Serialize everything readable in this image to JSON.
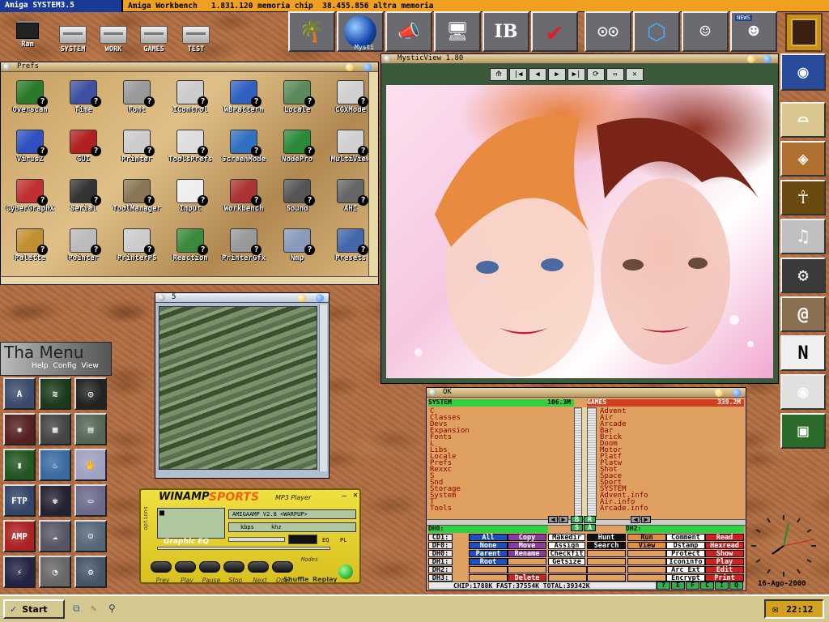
{
  "topbar": {
    "title": "Amiga SYSTEM3.5",
    "info": "Amiga Workbench   1.831.120 memoria chip  38.455.856 altra memoria"
  },
  "desktop_icons": [
    {
      "label": "Ram",
      "icon": "chip-icon"
    },
    {
      "label": "SYSTEM",
      "icon": "disk-icon"
    },
    {
      "label": "WORK",
      "icon": "disk-icon"
    },
    {
      "label": "GAMES",
      "icon": "disk-icon"
    },
    {
      "label": "TEST",
      "icon": "disk-icon"
    }
  ],
  "dock": {
    "sub_label": "Mysti",
    "news_badge": "NEWS"
  },
  "prefs": {
    "title": "Prefs",
    "icons": [
      {
        "label": "Overscan",
        "color": "#2a7a2a"
      },
      {
        "label": "Time",
        "color": "#4050a0"
      },
      {
        "label": "Font",
        "color": "#999999"
      },
      {
        "label": "IControl",
        "color": "#cccccc"
      },
      {
        "label": "WBPattern",
        "color": "#3060c0"
      },
      {
        "label": "Locale",
        "color": "#5a8a5a"
      },
      {
        "label": "CGXMode",
        "color": "#d0d0d0"
      },
      {
        "label": "VirusZ",
        "color": "#3050c0"
      },
      {
        "label": "GUI",
        "color": "#b02020"
      },
      {
        "label": "Printer",
        "color": "#cccccc"
      },
      {
        "label": "ToolsPrefs",
        "color": "#dddddd"
      },
      {
        "label": "ScreenMode",
        "color": "#3070c0"
      },
      {
        "label": "NodePro",
        "color": "#2a8a3a"
      },
      {
        "label": "MultiView",
        "color": "#d0d0d0"
      },
      {
        "label": "CyberGraphX",
        "color": "#c03030"
      },
      {
        "label": "Serial",
        "color": "#333333"
      },
      {
        "label": "ToolManager",
        "color": "#887755"
      },
      {
        "label": "Input",
        "color": "#eeeeee"
      },
      {
        "label": "Workbench",
        "color": "#aa3333"
      },
      {
        "label": "Sound",
        "color": "#555555"
      },
      {
        "label": "AHI",
        "color": "#666666"
      },
      {
        "label": "Palette",
        "color": "#c09030"
      },
      {
        "label": "Pointer",
        "color": "#bbbbbb"
      },
      {
        "label": "PrinterPS",
        "color": "#cccccc"
      },
      {
        "label": "Reaction",
        "color": "#3a8a3a"
      },
      {
        "label": "PrinterGfx",
        "color": "#999999"
      },
      {
        "label": "Nmp",
        "color": "#8899bb"
      },
      {
        "label": "Presets",
        "color": "#4466aa"
      }
    ]
  },
  "mystic": {
    "title": "MysticView 1.80",
    "controls": [
      "⟰",
      "|◀",
      "◀",
      "▶",
      "▶|",
      "⟳",
      "⇔",
      "✕"
    ]
  },
  "win5": {
    "title": "5"
  },
  "thamenu": {
    "title": "Tha Menu",
    "menu": [
      "Help",
      "Config",
      "View"
    ],
    "buttons": [
      {
        "name": "a-button",
        "sym": "A",
        "bg": "#3a4a6a"
      },
      {
        "name": "sound-button",
        "sym": "≋",
        "bg": "#1a3a1a"
      },
      {
        "name": "spiral-button",
        "sym": "◎",
        "bg": "#222222"
      },
      {
        "name": "fire-button",
        "sym": "✺",
        "bg": "#552020"
      },
      {
        "name": "device-button",
        "sym": "▦",
        "bg": "#444444"
      },
      {
        "name": "disk-button",
        "sym": "▤",
        "bg": "#556655"
      },
      {
        "name": "bars-button",
        "sym": "▮",
        "bg": "#225522"
      },
      {
        "name": "cup-button",
        "sym": "♨",
        "bg": "#3a6aa0"
      },
      {
        "name": "hand-button",
        "sym": "✋",
        "bg": "#a0a0c0"
      },
      {
        "name": "ftp-button",
        "sym": "FTP",
        "bg": "#334466"
      },
      {
        "name": "butterfly-button",
        "sym": "✾",
        "bg": "#222233"
      },
      {
        "name": "monitor-button",
        "sym": "▭",
        "bg": "#6a6a8a"
      },
      {
        "name": "amp-button",
        "sym": "AMP",
        "bg": "#aa2222"
      },
      {
        "name": "cloud-button",
        "sym": "☁",
        "bg": "#555566"
      },
      {
        "name": "face-button",
        "sym": "☺",
        "bg": "#556677"
      },
      {
        "name": "lightning-button",
        "sym": "⚡",
        "bg": "#222244"
      },
      {
        "name": "gauge-button",
        "sym": "◔",
        "bg": "#666666"
      },
      {
        "name": "tool-button",
        "sym": "⚙",
        "bg": "#445566"
      }
    ]
  },
  "winamp": {
    "brand": "WINAMP",
    "sports": "SPORTS",
    "sub": "MP3 Player",
    "options": "options",
    "eq": "Graphic EQ",
    "song": "AMIGAAMP V2.8 <WARPUP>",
    "kbps": "kbps",
    "khz": "khz",
    "eq_lbl": "EQ",
    "pl_lbl": "PL",
    "modes": "Modes",
    "shuffle": "Shuffle",
    "replay": "Replay",
    "buttons": [
      "Prev",
      "Play",
      "Pause",
      "Stop",
      "Next",
      "Open"
    ]
  },
  "dopus": {
    "title": "OK",
    "left": {
      "header": "SYSTEM",
      "size": "106.3M",
      "items": [
        "C",
        "Classes",
        "Devs",
        "Expansion",
        "Fonts",
        "L",
        "Libs",
        "Locale",
        "Prefs",
        "Rexxc",
        "S",
        "Snd",
        "Storage",
        "System",
        "T",
        "Tools"
      ]
    },
    "right": {
      "header": "GAMES",
      "size": "339.2M",
      "items": [
        "Advent",
        "Air",
        "Arcade",
        "Bar",
        "Brick",
        "Doom",
        "Motor",
        "Platf",
        "Platw",
        "Shot",
        "Space",
        "Sport",
        "SYSTEM",
        "Advent.info",
        "Air.info",
        "Arcade.info"
      ]
    },
    "mid_buttons": [
      "B",
      "R",
      "S",
      "A"
    ],
    "path_left": "DH0:",
    "path_right": "DH2:",
    "drives": [
      "CD1:",
      "DF0:",
      "DH0:",
      "DH1:",
      "DH2:",
      "DH3:"
    ],
    "col1": [
      {
        "t": "All",
        "c": "#1a50c0"
      },
      {
        "t": "None",
        "c": "#1a50c0"
      },
      {
        "t": "Parent",
        "c": "#1a50c0"
      },
      {
        "t": "Root",
        "c": "#1a50c0"
      }
    ],
    "col2": [
      {
        "t": "Copy",
        "c": "#8a3aa0"
      },
      {
        "t": "Move",
        "c": "#8a3aa0"
      },
      {
        "t": "Rename",
        "c": "#8a3aa0"
      },
      {
        "t": "Delete",
        "c": "#d02020"
      }
    ],
    "col3": [
      {
        "t": "Makedir",
        "c": "#ffffff"
      },
      {
        "t": "Assign",
        "c": "#ffffff"
      },
      {
        "t": "Checkfit",
        "c": "#ffffff"
      },
      {
        "t": "Getsize",
        "c": "#ffffff"
      }
    ],
    "col4": [
      {
        "t": "Hunt",
        "c": "#111111"
      },
      {
        "t": "Search",
        "c": "#111111"
      }
    ],
    "col5": [
      {
        "t": "Run",
        "c": "#e09040"
      },
      {
        "t": "View",
        "c": "#e09040"
      }
    ],
    "col6": [
      {
        "t": "Comment",
        "c": "#ffffff"
      },
      {
        "t": "Dstamp",
        "c": "#ffffff"
      },
      {
        "t": "Protect",
        "c": "#ffffff"
      },
      {
        "t": "Iconinfo",
        "c": "#ffffff"
      },
      {
        "t": "Arc Ext",
        "c": "#ffffff"
      },
      {
        "t": "Encrypt",
        "c": "#ffffff"
      }
    ],
    "col7": [
      {
        "t": "Read",
        "c": "#d02020"
      },
      {
        "t": "Hexread",
        "c": "#d02020"
      },
      {
        "t": "Show",
        "c": "#d02020"
      },
      {
        "t": "Play",
        "c": "#d02020"
      },
      {
        "t": "Edit",
        "c": "#d02020"
      },
      {
        "t": "Print",
        "c": "#d02020"
      }
    ],
    "status": "CHIP:1788K  FAST:37554K  TOTAL:39342K",
    "status_btns": [
      "?",
      "E",
      "F",
      "C",
      "I",
      "Q"
    ]
  },
  "clock": {
    "date": "16-Ago-2000"
  },
  "taskbar": {
    "start": "Start",
    "time": "22:12"
  },
  "right_dock": [
    {
      "name": "eye-globe-button",
      "bg": "#2a4a9a",
      "sym": "◉"
    },
    {
      "name": "mouse-button",
      "bg": "#d8c890",
      "sym": "⌓"
    },
    {
      "name": "picture-eye-button",
      "bg": "#b07030",
      "sym": "◈"
    },
    {
      "name": "pharaoh-button",
      "bg": "#6a4a10",
      "sym": "☥"
    },
    {
      "name": "music-button",
      "bg": "#c0c0c0",
      "sym": "♫"
    },
    {
      "name": "gears-button",
      "bg": "#3a3a3a",
      "sym": "⚙"
    },
    {
      "name": "shell-button",
      "bg": "#8a7050",
      "sym": "@"
    },
    {
      "name": "netscape-button",
      "bg": "#f0f0f0",
      "sym": "N"
    },
    {
      "name": "eye-button",
      "bg": "#e0e0e0",
      "sym": "◉"
    },
    {
      "name": "paint-button",
      "bg": "#2a6a2a",
      "sym": "▣"
    }
  ]
}
